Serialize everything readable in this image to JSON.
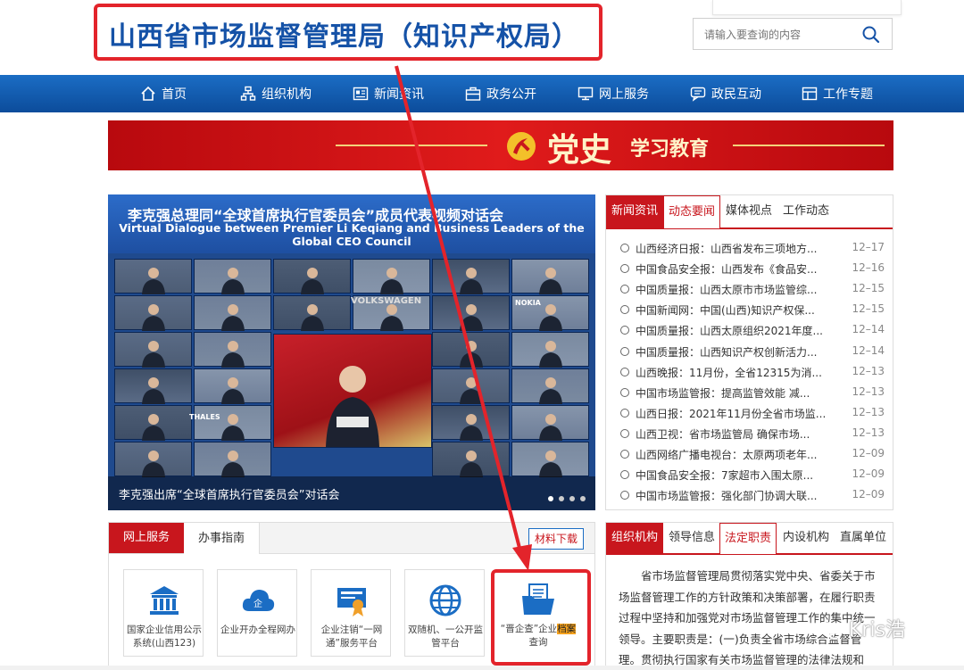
{
  "header": {
    "site_title": "山西省市场监督管理局（知识产权局）",
    "search_placeholder": "请输入要查询的内容"
  },
  "nav": {
    "items": [
      {
        "label": "首页",
        "icon": "home-icon"
      },
      {
        "label": "组织机构",
        "icon": "org-chart-icon"
      },
      {
        "label": "新闻资讯",
        "icon": "news-icon"
      },
      {
        "label": "政务公开",
        "icon": "briefcase-icon"
      },
      {
        "label": "网上服务",
        "icon": "monitor-icon"
      },
      {
        "label": "政民互动",
        "icon": "chat-icon"
      },
      {
        "label": "工作专题",
        "icon": "layout-icon"
      }
    ]
  },
  "banner": {
    "title": "党史",
    "subtitle": "学习教育"
  },
  "slideshow": {
    "heading_cn": "李克强总理同“全球首席执行官委员会”成员代表视频对话会",
    "heading_en": "Virtual Dialogue between Premier Li Keqiang and Business Leaders of the Global CEO Council",
    "caption": "李克强出席“全球首席执行官委员会”对话会",
    "tile_labels": [
      "VOLKSWAGEN",
      "NOKIA",
      "THALES"
    ]
  },
  "news": {
    "tabs": [
      "新闻资讯",
      "动态要闻",
      "媒体视点",
      "工作动态"
    ],
    "items": [
      {
        "text": "山西经济日报：山西省发布三项地方...",
        "date": "12–17"
      },
      {
        "text": "中国食品安全报：山西发布《食品安...",
        "date": "12–16"
      },
      {
        "text": "中国质量报：山西太原市市场监管综...",
        "date": "12–15"
      },
      {
        "text": "中国新闻网：中国(山西)知识产权保...",
        "date": "12–15"
      },
      {
        "text": "中国质量报：山西太原组织2021年度...",
        "date": "12–14"
      },
      {
        "text": "中国质量报：山西知识产权创新活力...",
        "date": "12–14"
      },
      {
        "text": "山西晚报：11月份，全省12315为消...",
        "date": "12–13"
      },
      {
        "text": "中国市场监管报：提高监管效能 减...",
        "date": "12–13"
      },
      {
        "text": "山西日报：2021年11月份全省市场监...",
        "date": "12–13"
      },
      {
        "text": "山西卫视：省市场监管局 确保市场...",
        "date": "12–13"
      },
      {
        "text": "山西网络广播电视台：太原两项老年...",
        "date": "12–09"
      },
      {
        "text": "中国食品安全报：7家超市入围太原...",
        "date": "12–09"
      },
      {
        "text": "中国市场监管报：强化部门协调大联...",
        "date": "12–09"
      }
    ]
  },
  "services": {
    "tab_online": "网上服务",
    "tab_guide": "办事指南",
    "download_label": "材料下载",
    "cards": [
      {
        "label": "国家企业信用公示系统(山西123)",
        "icon": "bank-icon"
      },
      {
        "label": "企业开办全程网办",
        "icon": "cloud-icon"
      },
      {
        "label": "企业注销“一网通”服务平台",
        "icon": "certificate-icon"
      },
      {
        "label": "双随机、一公开监管平台",
        "icon": "globe-icon"
      },
      {
        "label_pre": "“晋企查”企业",
        "label_hl": "档案",
        "label_post": "查询",
        "icon": "folder-icon"
      }
    ]
  },
  "org": {
    "tabs": [
      "组织机构",
      "领导信息",
      "法定职责",
      "内设机构",
      "直属单位"
    ],
    "text": "省市场监督管理局贯彻落实党中央、省委关于市场监督管理工作的方针政策和决策部署，在履行职责过程中坚持和加强党对市场监督管理工作的集中统一领导。主要职责是：(一)负责全省市场综合监督管理。贯彻执行国家有关市场监督管理的法律法规和意..."
  },
  "watermark": "Kris浩",
  "colors": {
    "nav_blue": "#1b6dc4",
    "brand_red": "#c8161d",
    "title_blue": "#1552a7",
    "annotation_red": "#e3242b"
  }
}
